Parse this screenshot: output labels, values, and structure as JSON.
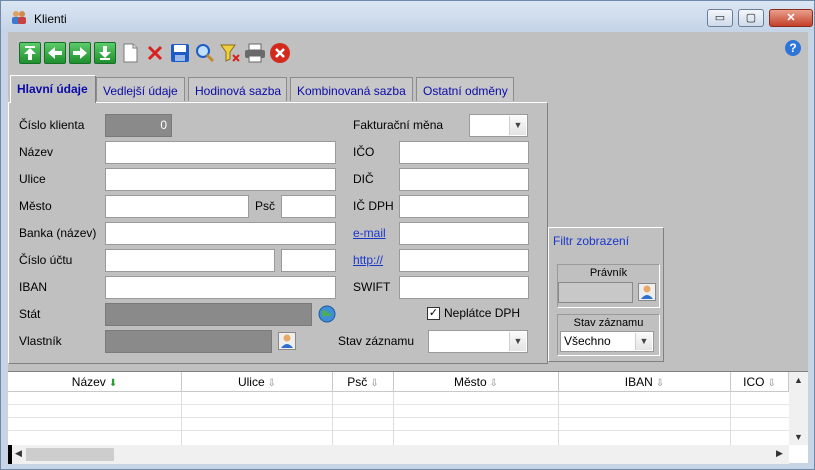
{
  "window": {
    "title": "Klienti",
    "min_label": "▭",
    "max_label": "▢",
    "close_label": "✕"
  },
  "toolbar": {
    "buttons": [
      "first",
      "previous",
      "next",
      "last",
      "new",
      "delete",
      "save",
      "search",
      "filter-clear",
      "print",
      "close"
    ],
    "help_label": "?"
  },
  "tabs": [
    {
      "label": "Hlavní údaje",
      "active": true
    },
    {
      "label": "Vedlejší údaje",
      "active": false
    },
    {
      "label": "Hodinová sazba",
      "active": false
    },
    {
      "label": "Kombinovaná sazba",
      "active": false
    },
    {
      "label": "Ostatní odměny",
      "active": false
    }
  ],
  "form_left": {
    "cislo_klienta_label": "Číslo klienta",
    "cislo_klienta_value": "0",
    "nazev_label": "Název",
    "ulice_label": "Ulice",
    "mesto_label": "Město",
    "psc_label": "Psč",
    "banka_label": "Banka (název)",
    "cislo_uctu_label": "Číslo účtu",
    "iban_label": "IBAN",
    "stat_label": "Stát",
    "vlastnik_label": "Vlastník"
  },
  "form_right": {
    "mena_label": "Fakturační měna",
    "mena_value": "",
    "ico_label": "IČO",
    "dic_label": "DIČ",
    "icdph_label": "IČ DPH",
    "email_label": "e-mail",
    "http_label": "http://",
    "swift_label": "SWIFT",
    "neplatce_label": "Neplátce DPH",
    "neplatce_checked": true,
    "stav_label": "Stav záznamu",
    "stav_value": ""
  },
  "filter": {
    "title": "Filtr zobrazení",
    "pravnik_label": "Právník",
    "pravnik_value": "",
    "stav_label": "Stav záznamu",
    "stav_value": "Všechno"
  },
  "grid": {
    "columns": [
      {
        "label": "Název",
        "sorted": true
      },
      {
        "label": "Ulice",
        "sorted": false
      },
      {
        "label": "Psč",
        "sorted": false
      },
      {
        "label": "Město",
        "sorted": false
      },
      {
        "label": "IBAN",
        "sorted": false
      },
      {
        "label": "ICO",
        "sorted": false
      }
    ],
    "rows": []
  },
  "colors": {
    "window_bg": "#c6d4e6",
    "client_bg": "#c0c0c0",
    "tab_text": "#0a0aa8",
    "link": "#1a37cc",
    "disabled_field": "#8a8a8a",
    "close_button": "#c4402a"
  }
}
